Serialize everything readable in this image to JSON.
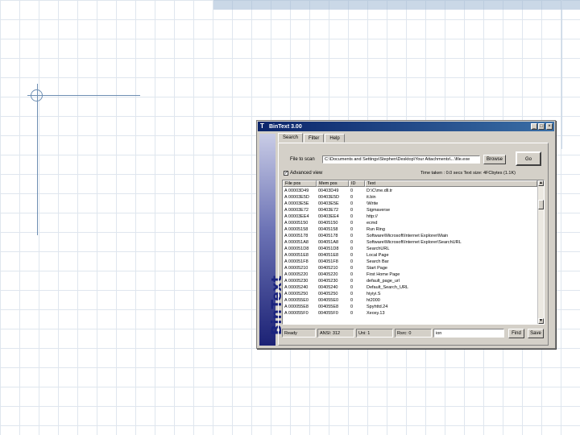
{
  "window": {
    "title": "BinText 3.00",
    "icon_glyph": "T",
    "minimize": "_",
    "maximize": "□",
    "close": "×"
  },
  "tabs": [
    "Search",
    "Filter",
    "Help"
  ],
  "logo": "BinText",
  "file": {
    "label": "File to scan",
    "value": "C:\\Documents and Settings\\Stephen\\Desktop\\Your Attachments\\...\\file.exe",
    "browse": "Browse",
    "go": "Go"
  },
  "advanced_view": {
    "checked": true,
    "label": "Advanced view"
  },
  "time_info": "Time taken : 0.0 secs   Text size: 4FCbytes (1.1K)",
  "columns": [
    "File pos",
    "Mem pos",
    "ID",
    "Text"
  ],
  "rows": [
    [
      "A 00003D49",
      "00403D49",
      "0",
      "D:\\C\\me.dll.tr"
    ],
    [
      "A 00003E5D",
      "00403E5D",
      "0",
      "it.bin"
    ],
    [
      "A 00003E5E",
      "00403E5E",
      "0",
      "\\Write"
    ],
    [
      "A 00003E72",
      "00403E72",
      "0",
      "Sigmaverse"
    ],
    [
      "A 00003EE4",
      "00403EE4",
      "0",
      "http://"
    ],
    [
      "A 00005150",
      "00405150",
      "0",
      "ecmd"
    ],
    [
      "A 00005158",
      "00405158",
      "0",
      "Run Ring"
    ],
    [
      "A 00005178",
      "00405178",
      "0",
      "Software\\Microsoft\\Internet Explorer\\Main"
    ],
    [
      "A 000051A8",
      "004051A8",
      "0",
      "Software\\Microsoft\\Internet Explorer\\SearchURL"
    ],
    [
      "A 000051D8",
      "004051D8",
      "0",
      "SearchURL"
    ],
    [
      "A 000051E8",
      "004051E8",
      "0",
      "Local Page"
    ],
    [
      "A 000051F8",
      "004051F8",
      "0",
      "Search Bar"
    ],
    [
      "A 00005210",
      "00405210",
      "0",
      "Start Page"
    ],
    [
      "A 00005220",
      "00405220",
      "0",
      "First Home Page"
    ],
    [
      "A 00005230",
      "00405230",
      "0",
      "default_page_url"
    ],
    [
      "A 00005240",
      "00405240",
      "0",
      "Default_Search_URL"
    ],
    [
      "A 00005250",
      "00405250",
      "0",
      "hiyiyi.S"
    ],
    [
      "A 000055E0",
      "004055E0",
      "0",
      "ht2000"
    ],
    [
      "A 000055E8",
      "004055E8",
      "0",
      "Spyhttd.24"
    ],
    [
      "A 000055F0",
      "004055F0",
      "0",
      "Xeoxy.13"
    ]
  ],
  "status": {
    "ready": "Ready",
    "ansi": "ANSI: 312",
    "uni": "Uni: 1",
    "rsrc": "Rsrc: 0",
    "search_value": "ion",
    "find": "Find",
    "save": "Save"
  }
}
